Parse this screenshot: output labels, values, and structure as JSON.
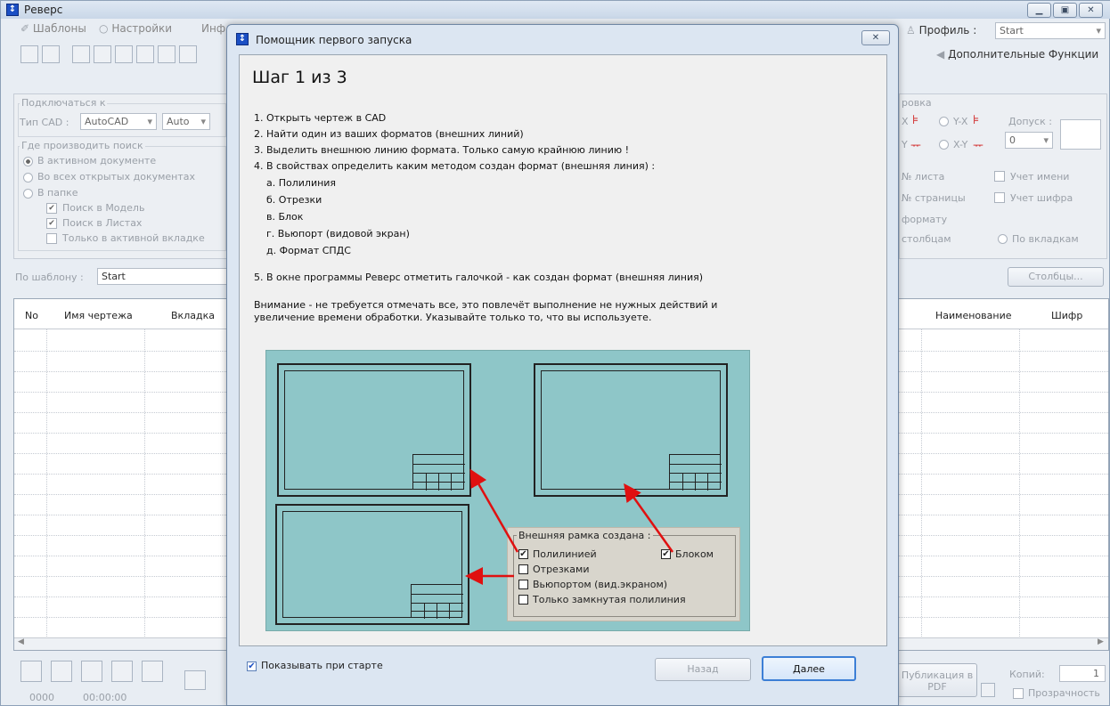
{
  "app": {
    "title": "Реверс",
    "icon": "app-logo-icon",
    "window_buttons": [
      "minimize-icon",
      "maximize-icon",
      "close-icon"
    ]
  },
  "menu": {
    "templates": "Шаблоны",
    "settings": "Настройки",
    "info": "Инф",
    "profile_label": "Профиль :",
    "profile_value": "Start",
    "extra_functions": "Дополнительные Функции"
  },
  "left_panel": {
    "connect_group": "Подключаться к",
    "cad_type_label": "Тип CAD :",
    "cad_type_value": "AutoCAD",
    "version_value": "Auto",
    "search_group": "Где производить поиск",
    "radio_active_doc": "В активном документе",
    "radio_all_docs": "Во всех открытых документах",
    "radio_folder": "В папке",
    "check_model": "Поиск в Модель",
    "check_sheets": "Поиск в Листах",
    "check_active_tab": "Только в активной вкладке",
    "by_template_label": "По шаблону :",
    "by_template_value": "Start"
  },
  "right_panel": {
    "group_label": "ровка",
    "opt_x": "X",
    "opt_yx": "Y-X",
    "opt_y": "Y",
    "opt_xy": "X-Y",
    "tolerance_label": "Допуск :",
    "tolerance_value": "0",
    "sheet_no": "№ листа",
    "page_no": "№ страницы",
    "by_format": "формату",
    "by_columns": "столбцам",
    "use_name": "Учет имени",
    "use_code": "Учет шифра",
    "by_tabs": "По вкладкам",
    "columns_button": "Столбцы..."
  },
  "table": {
    "columns_left": [
      "No",
      "Имя чертежа",
      "Вкладка"
    ],
    "columns_right": [
      "Наименование",
      "Шифр"
    ]
  },
  "bottom": {
    "counter": "0000",
    "time": "00:00:00",
    "publish_label": "Публикация в",
    "publish_format": "PDF",
    "copies_label": "Копий:",
    "copies_value": "1",
    "transparency": "Прозрачность"
  },
  "dialog": {
    "title": "Помощник первого запуска",
    "step_heading": "Шаг 1 из 3",
    "steps": [
      "1. Открыть чертеж в CAD",
      "2. Найти один из ваших форматов (внешних линий)",
      "3. Выделить внешнюю линию формата. Только самую крайнюю линию !",
      "4. В свойствах определить каким методом создан формат (внешняя линия) :"
    ],
    "substeps": [
      "а. Полилиния",
      "б. Отрезки",
      "в. Блок",
      "г. Вьюпорт (видовой экран)",
      "д. Формат СПДС"
    ],
    "step5": "5. В окне программы Реверс отметить галочкой - как создан формат (внешняя линия)",
    "warning_line1": "Внимание - не требуется отмечать все, это повлечёт выполнение не нужных действий и",
    "warning_line2": "увеличение времени обработки. Указывайте только то, что вы используете.",
    "diagram": {
      "group_title": "Внешняя рамка создана :",
      "opt_polyline": "Полилинией",
      "opt_block": "Блоком",
      "opt_segments": "Отрезками",
      "opt_viewport": "Вьюпортом (вид.экраном)",
      "opt_closed": "Только замкнутая полилиния",
      "checked_polyline": "✔",
      "checked_block": "✔"
    },
    "show_on_start": "Показывать при старте",
    "back_button": "Назад",
    "next_button": "Далее"
  },
  "colors": {
    "diagram_bg": "#8ec6c8",
    "arrow": "#e01010",
    "accent": "#3c7fd6"
  }
}
